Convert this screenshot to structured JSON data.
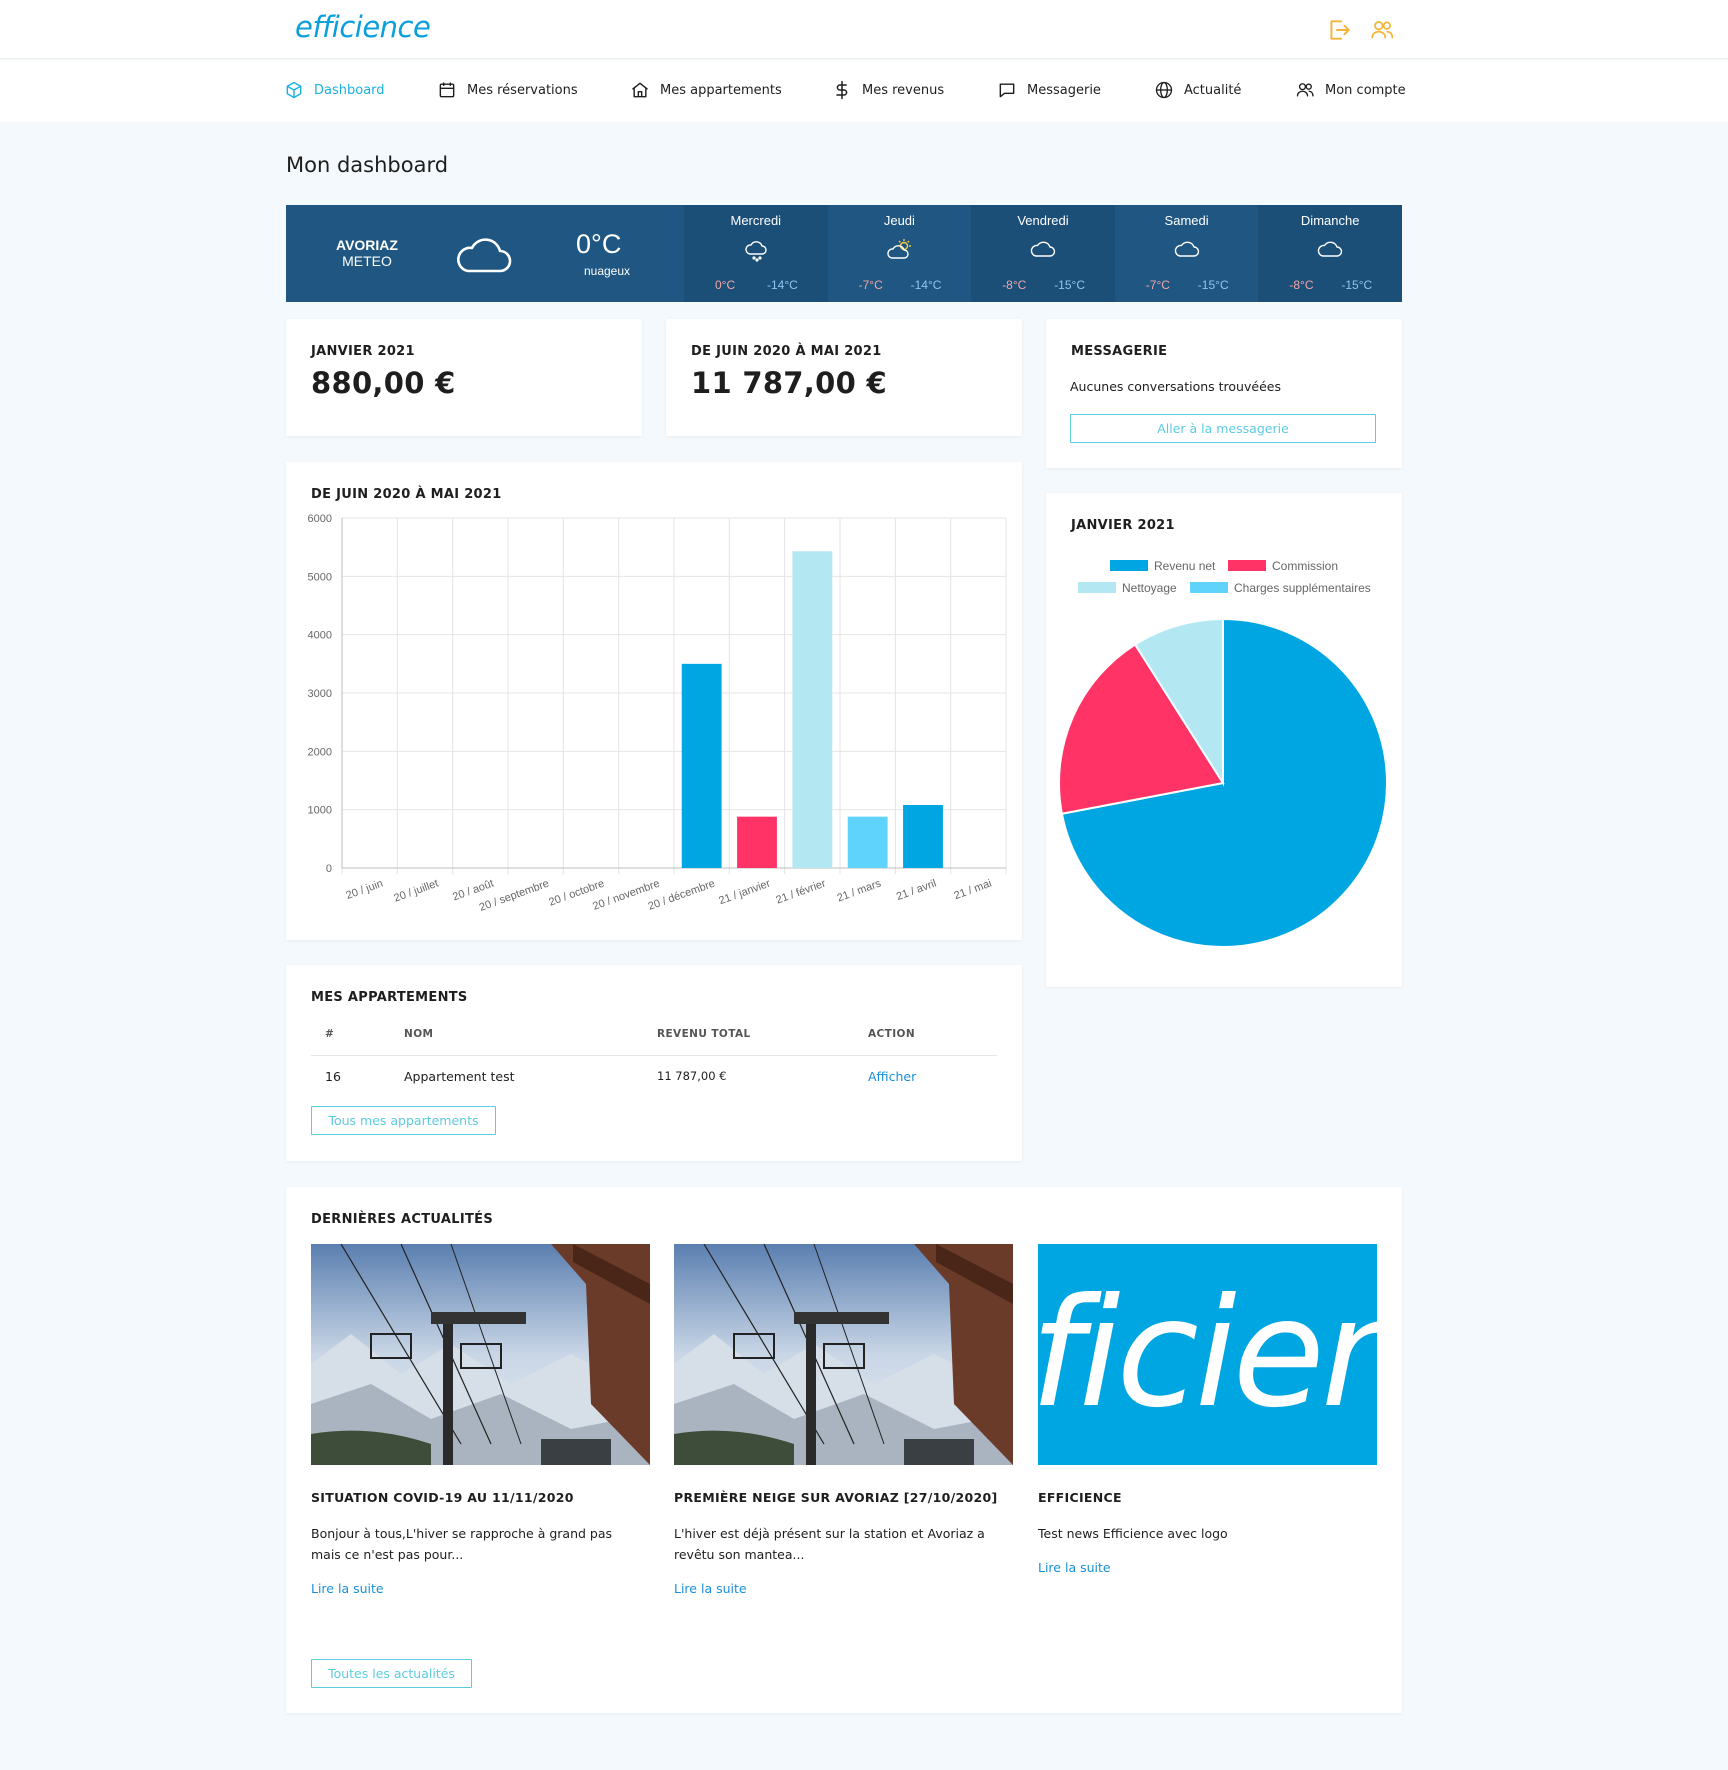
{
  "brand": {
    "logo": "efficience",
    "accent": "#1ab0e0",
    "warning_icon_color": "#f5b53a"
  },
  "topbar": {
    "logout_icon": "logout-icon",
    "account_icon": "users-icon"
  },
  "nav": {
    "items": [
      {
        "label": "Dashboard",
        "icon": "cube-icon",
        "active": true
      },
      {
        "label": "Mes réservations",
        "icon": "calendar-icon"
      },
      {
        "label": "Mes appartements",
        "icon": "home-icon"
      },
      {
        "label": "Mes revenus",
        "icon": "dollar-icon"
      },
      {
        "label": "Messagerie",
        "icon": "message-icon"
      },
      {
        "label": "Actualité",
        "icon": "globe-icon"
      },
      {
        "label": "Mon compte",
        "icon": "users-icon"
      }
    ]
  },
  "page": {
    "title": "Mon dashboard"
  },
  "weather": {
    "city": "AVORIAZ",
    "subtitle": "METEO",
    "temp": "0°C",
    "condition": "nuageux",
    "days": [
      {
        "name": "Mercredi",
        "icon": "snow-cloud-icon",
        "hi": "0°C",
        "lo": "-14°C"
      },
      {
        "name": "Jeudi",
        "icon": "sun-cloud-icon",
        "hi": "-7°C",
        "lo": "-14°C"
      },
      {
        "name": "Vendredi",
        "icon": "cloud-icon",
        "hi": "-8°C",
        "lo": "-15°C"
      },
      {
        "name": "Samedi",
        "icon": "cloud-icon",
        "hi": "-7°C",
        "lo": "-15°C"
      },
      {
        "name": "Dimanche",
        "icon": "cloud-icon",
        "hi": "-8°C",
        "lo": "-15°C"
      }
    ]
  },
  "stats": {
    "month": {
      "label": "JANVIER 2021",
      "value": "880,00 €"
    },
    "year": {
      "label": "DE JUIN 2020 À MAI 2021",
      "value": "11 787,00 €"
    }
  },
  "messagerie": {
    "title": "MESSAGERIE",
    "empty_text": "Aucunes conversations trouvéées",
    "button": "Aller à la messagerie"
  },
  "bar_card": {
    "title": "DE JUIN 2020 À MAI 2021"
  },
  "pie_card": {
    "title": "JANVIER 2021"
  },
  "chart_data": [
    {
      "type": "bar",
      "title": "DE JUIN 2020 À MAI 2021",
      "categories": [
        "20 / juin",
        "20 / juillet",
        "20 / août",
        "20 / septembre",
        "20 / octobre",
        "20 / novembre",
        "20 / décembre",
        "21 / janvier",
        "21 / février",
        "21 / mars",
        "21 / avril",
        "21 / mai"
      ],
      "values": [
        0,
        0,
        0,
        0,
        0,
        0,
        3500,
        880,
        5430,
        880,
        1080,
        0
      ],
      "bar_colors": [
        "#00a6e2",
        "#00a6e2",
        "#00a6e2",
        "#00a6e2",
        "#00a6e2",
        "#00a6e2",
        "#00a6e2",
        "#ff3366",
        "#b3e8f2",
        "#5fd3fb",
        "#00a6e2",
        "#00a6e2"
      ],
      "ylim": [
        0,
        6000
      ],
      "yticks": [
        0,
        1000,
        2000,
        3000,
        4000,
        5000,
        6000
      ],
      "grid": true
    },
    {
      "type": "pie",
      "title": "JANVIER 2021",
      "labels": [
        "Revenu net",
        "Commission",
        "Nettoyage",
        "Charges supplémentaires"
      ],
      "values": [
        72,
        19,
        9,
        0
      ],
      "colors": [
        "#00a6e2",
        "#ff3366",
        "#b3e8f2",
        "#5fd3fb"
      ],
      "legend": "top"
    }
  ],
  "apartments": {
    "title": "MES APPARTEMENTS",
    "headers": [
      "#",
      "NOM",
      "REVENU TOTAL",
      "ACTION"
    ],
    "rows": [
      {
        "id": "16",
        "name": "Appartement test",
        "revenue": "11 787,00 €",
        "action": "Afficher"
      }
    ],
    "button": "Tous mes appartements"
  },
  "news": {
    "title": "DERNIÈRES ACTUALITÉS",
    "items": [
      {
        "title": "SITUATION COVID-19 AU 11/11/2020",
        "body": "Bonjour à tous,L'hiver se rapproche à grand pas mais ce n'est pas pour...",
        "link": "Lire la suite",
        "image": "ski-lift-photo"
      },
      {
        "title": "PREMIÈRE NEIGE SUR AVORIAZ [27/10/2020]",
        "body": "L'hiver est déjà présent sur la station et Avoriaz a revêtu son mantea...",
        "link": "Lire la suite",
        "image": "ski-lift-photo"
      },
      {
        "title": "EFFICIENCE",
        "body": "Test news Efficience avec logo",
        "link": "Lire la suite",
        "image": "efficience-logo-image",
        "image_text": "ficien"
      }
    ],
    "button": "Toutes les actualités"
  }
}
